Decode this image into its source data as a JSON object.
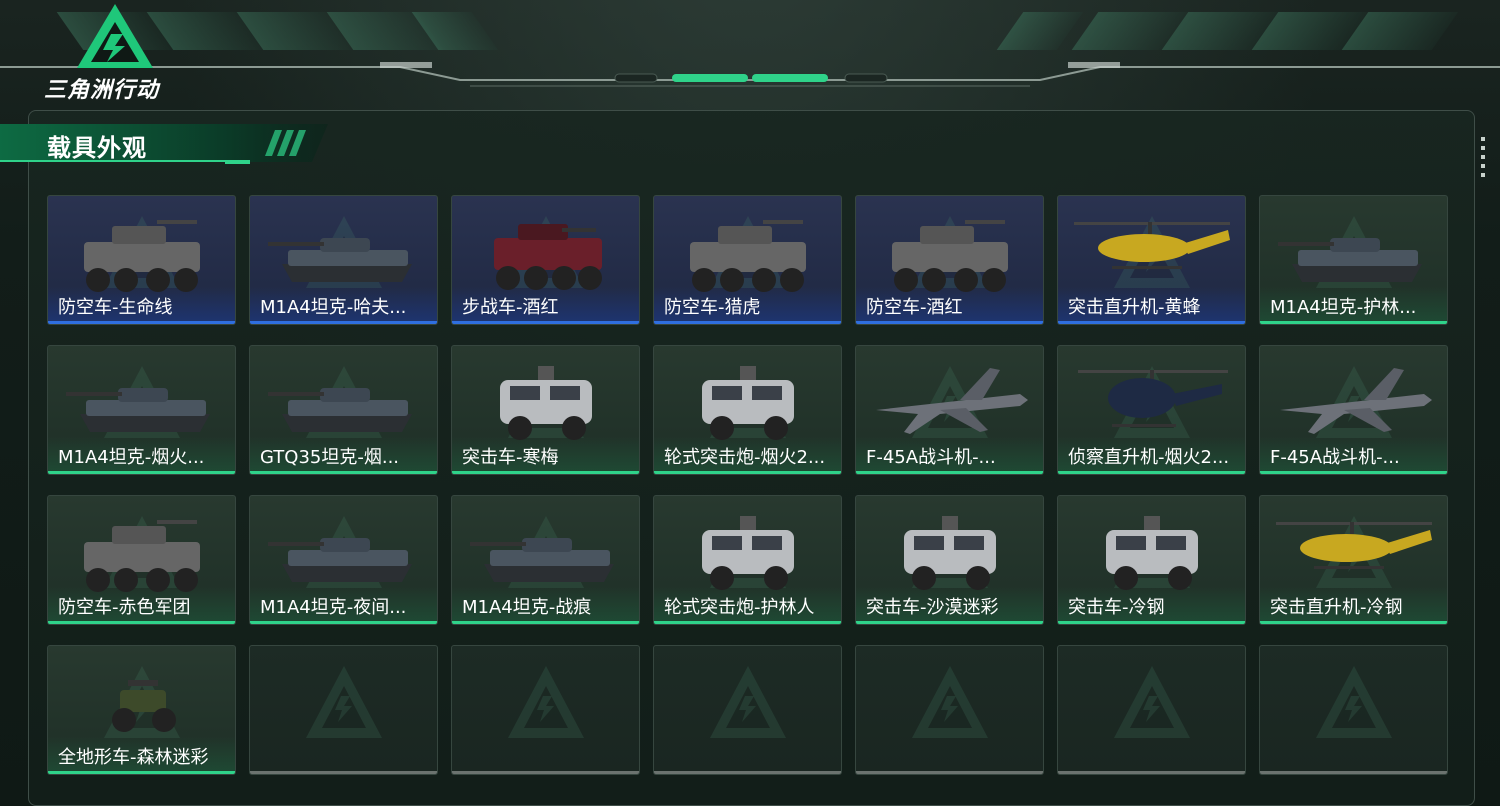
{
  "app": {
    "title": "三角洲行动"
  },
  "section": {
    "title": "载具外观"
  },
  "colors": {
    "accent": "#2fd38a",
    "blue_rarity": "#2f6fe0",
    "empty": "#6b736f"
  },
  "cards": [
    {
      "label": "防空车-生命线",
      "rarity": "blue",
      "icon": "wheeled-aa-vehicle-icon"
    },
    {
      "label": "M1A4坦克-哈夫...",
      "rarity": "blue",
      "icon": "tank-icon"
    },
    {
      "label": "步战车-酒红",
      "rarity": "blue",
      "icon": "wheeled-ifv-icon"
    },
    {
      "label": "防空车-猎虎",
      "rarity": "blue",
      "icon": "wheeled-aa-vehicle-icon"
    },
    {
      "label": "防空车-酒红",
      "rarity": "blue",
      "icon": "wheeled-aa-vehicle-icon"
    },
    {
      "label": "突击直升机-黄蜂",
      "rarity": "blue",
      "icon": "attack-helicopter-icon"
    },
    {
      "label": "M1A4坦克-护林...",
      "rarity": "green",
      "icon": "tank-icon"
    },
    {
      "label": "M1A4坦克-烟火...",
      "rarity": "green",
      "icon": "tank-icon"
    },
    {
      "label": "GTQ35坦克-烟...",
      "rarity": "green",
      "icon": "tank-icon"
    },
    {
      "label": "突击车-寒梅",
      "rarity": "green",
      "icon": "armored-car-icon"
    },
    {
      "label": "轮式突击炮-烟火2...",
      "rarity": "green",
      "icon": "armored-car-icon"
    },
    {
      "label": "F-45A战斗机-...",
      "rarity": "green",
      "icon": "fighter-jet-icon"
    },
    {
      "label": "侦察直升机-烟火2...",
      "rarity": "green",
      "icon": "scout-helicopter-icon"
    },
    {
      "label": "F-45A战斗机-...",
      "rarity": "green",
      "icon": "fighter-jet-icon"
    },
    {
      "label": "防空车-赤色军团",
      "rarity": "green",
      "icon": "wheeled-aa-vehicle-icon"
    },
    {
      "label": "M1A4坦克-夜间...",
      "rarity": "green",
      "icon": "tank-icon"
    },
    {
      "label": "M1A4坦克-战痕",
      "rarity": "green",
      "icon": "tank-icon"
    },
    {
      "label": "轮式突击炮-护林人",
      "rarity": "green",
      "icon": "armored-car-icon"
    },
    {
      "label": "突击车-沙漠迷彩",
      "rarity": "green",
      "icon": "armored-car-icon"
    },
    {
      "label": "突击车-冷钢",
      "rarity": "green",
      "icon": "armored-car-icon"
    },
    {
      "label": "突击直升机-冷钢",
      "rarity": "green",
      "icon": "attack-helicopter-icon"
    },
    {
      "label": "全地形车-森林迷彩",
      "rarity": "green",
      "icon": "atv-icon"
    },
    {
      "label": "",
      "rarity": "empty",
      "icon": "empty-slot-logo-icon"
    },
    {
      "label": "",
      "rarity": "empty",
      "icon": "empty-slot-logo-icon"
    },
    {
      "label": "",
      "rarity": "empty",
      "icon": "empty-slot-logo-icon"
    },
    {
      "label": "",
      "rarity": "empty",
      "icon": "empty-slot-logo-icon"
    },
    {
      "label": "",
      "rarity": "empty",
      "icon": "empty-slot-logo-icon"
    },
    {
      "label": "",
      "rarity": "empty",
      "icon": "empty-slot-logo-icon"
    }
  ]
}
